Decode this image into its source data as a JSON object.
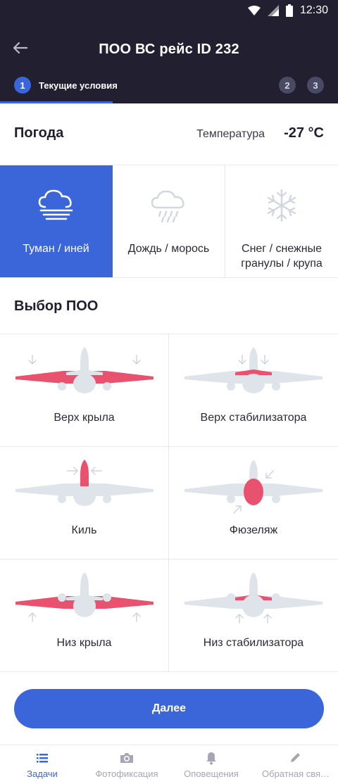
{
  "status_bar": {
    "time": "12:30"
  },
  "app_bar": {
    "title": "ПОО ВС рейс ID 232"
  },
  "stepper": {
    "steps": [
      {
        "number": "1",
        "label": "Текущие условия"
      },
      {
        "number": "2"
      },
      {
        "number": "3"
      }
    ]
  },
  "weather": {
    "title": "Погода",
    "temperature_label": "Температура",
    "temperature_value": "-27 °C",
    "options": [
      {
        "label": "Туман / иней",
        "icon": "fog-icon",
        "selected": true
      },
      {
        "label": "Дождь / морось",
        "icon": "rain-icon",
        "selected": false
      },
      {
        "label": "Снег / снежные гранулы / крупа",
        "icon": "snowflake-icon",
        "selected": false
      }
    ]
  },
  "poo": {
    "title": "Выбор ПОО",
    "options": [
      {
        "label": "Верх крыла",
        "icon": "plane-wing-top-icon"
      },
      {
        "label": "Верх стабилизатора",
        "icon": "plane-stabilizer-top-icon"
      },
      {
        "label": "Киль",
        "icon": "plane-fin-icon"
      },
      {
        "label": "Фюзеляж",
        "icon": "plane-fuselage-icon"
      },
      {
        "label": "Низ крыла",
        "icon": "plane-wing-bottom-icon"
      },
      {
        "label": "Низ стабилизатора",
        "icon": "plane-stabilizer-bottom-icon"
      }
    ]
  },
  "next_button": {
    "label": "Далее"
  },
  "bottom_nav": {
    "items": [
      {
        "label": "Задачи",
        "icon": "list-icon",
        "active": true
      },
      {
        "label": "Фотофиксация",
        "icon": "camera-icon",
        "active": false
      },
      {
        "label": "Оповещения",
        "icon": "bell-icon",
        "active": false
      },
      {
        "label": "Обратная свя…",
        "icon": "pencil-icon",
        "active": false
      }
    ]
  },
  "colors": {
    "header_bg": "#221f30",
    "accent": "#3b66d9",
    "highlight": "#e8526f",
    "plane_gray": "#dfe3ea"
  }
}
